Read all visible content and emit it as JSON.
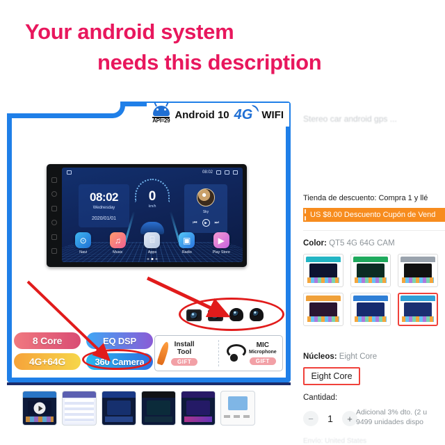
{
  "headline": {
    "line1": "Your android system",
    "line2": "needs this description",
    "color": "#e8175d"
  },
  "product_image": {
    "top_badges": {
      "api_label": "API=29",
      "android_label": "Android 10",
      "network_label": "4G",
      "wifi_label": "WIFI",
      "android_icon": "android-robot-icon",
      "accent_color": "#1f6fd4"
    },
    "head_unit": {
      "status_time": "08:02",
      "clock_time": "08:02",
      "clock_day": "Wednesday",
      "clock_date": "2020/01/01",
      "speed_value": "0",
      "speed_unit": "km/h",
      "media_title": "Sky",
      "apps": [
        {
          "label": "Navi",
          "icon": "location-pin-icon",
          "color1": "#3fb6f0",
          "color2": "#1f6fd4"
        },
        {
          "label": "Music",
          "icon": "music-note-icon",
          "color1": "#ff9a6c",
          "color2": "#f06292"
        },
        {
          "label": "Apps",
          "icon": "grid-apps-icon",
          "color1": "#dfe8f5",
          "color2": "#b9c9e2"
        },
        {
          "label": "Radio",
          "icon": "radio-icon",
          "color1": "#55c8f7",
          "color2": "#2a74e0"
        },
        {
          "label": "Play Store",
          "icon": "play-store-icon",
          "color1": "#f59ad0",
          "color2": "#c663e0"
        }
      ]
    },
    "feature_pills": [
      {
        "label": "8 Core",
        "style": "p1"
      },
      {
        "label": "EQ DSP",
        "style": "p2"
      },
      {
        "label": "4G+64G",
        "style": "p3"
      },
      {
        "label": "360 Camera",
        "style": "p4"
      }
    ],
    "gifts": [
      {
        "title": "Install",
        "subtitle": "Tool",
        "tag": "GIFT",
        "icon": "pry-tool-icon"
      },
      {
        "title": "MIC",
        "subtitle": "Microphone",
        "tag": "GIFT",
        "icon": "microphone-icon"
      }
    ],
    "cameras_count": 4,
    "annotation_color": "#e11b1b"
  },
  "thumbnails": [
    {
      "name": "video-thumbnail",
      "has_play": true
    },
    {
      "name": "spec-table-thumbnail",
      "has_play": false
    },
    {
      "name": "camera-kit-thumbnail",
      "has_play": false
    },
    {
      "name": "dashboard-install-thumbnail",
      "has_play": false
    },
    {
      "name": "screen-mirror-thumbnail",
      "has_play": false
    },
    {
      "name": "packing-list-thumbnail",
      "has_play": false
    }
  ],
  "right_panel": {
    "title_faded": "Stereo car android gps ...",
    "promo_text": "Tienda de descuento: Compra 1 y llé",
    "coupon_text": "US $8.00 Descuento Cupón de Vend",
    "color_label": "Color:",
    "color_value": "QT5 4G 64G CAM",
    "swatches": [
      {
        "name": "swatch-teal",
        "top": "#23b5c4",
        "selected": false
      },
      {
        "name": "swatch-green",
        "top": "#1faa5d",
        "selected": false
      },
      {
        "name": "swatch-gray",
        "top": "#9aa3ad",
        "selected": false
      },
      {
        "name": "swatch-orange",
        "top": "#f0a13a",
        "selected": false
      },
      {
        "name": "swatch-blue",
        "top": "#2f7fd6",
        "selected": false
      },
      {
        "name": "swatch-blue-selected",
        "top": "#2f9fd6",
        "selected": true
      }
    ],
    "cores_label": "Núcleos:",
    "cores_value": "Eight Core",
    "cores_button": "Eight Core",
    "quantity_label": "Cantidad:",
    "quantity_minus": "−",
    "quantity_value": "1",
    "quantity_plus": "+",
    "quantity_note_line1": "Adicional 3% dto. (2 u",
    "quantity_note_line2": "9499 unidades dispo",
    "bottom_faint": "Envío:   United States",
    "selected_border_color": "#f0413a",
    "coupon_color": "#f78c1e"
  }
}
